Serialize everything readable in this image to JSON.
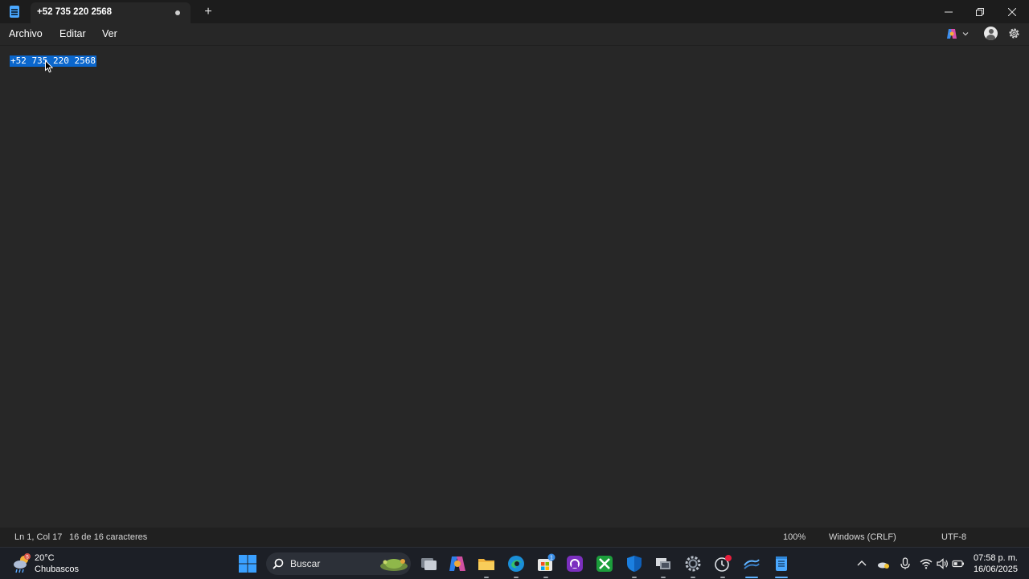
{
  "window": {
    "tab_title": "+52 735 220 2568",
    "new_tab_symbol": "+",
    "controls": [
      "minimize-icon",
      "maximize-icon",
      "close-icon"
    ]
  },
  "menu": {
    "archivo": "Archivo",
    "editar": "Editar",
    "ver": "Ver"
  },
  "editor": {
    "content": "+52 735 220 2568",
    "selected": true
  },
  "statusbar": {
    "position": "Ln 1, Col 17",
    "chars": "16 de 16 caracteres",
    "zoom": "100%",
    "line_ending": "Windows (CRLF)",
    "encoding": "UTF-8"
  },
  "taskbar": {
    "weather": {
      "badge": "5",
      "temp": "20°C",
      "condition": "Chubascos"
    },
    "search_placeholder": "Buscar",
    "store_badge": "1",
    "apps": [
      "task-view-icon",
      "copilot-icon",
      "file-explorer-icon",
      "edge-icon",
      "store-icon",
      "app-icon",
      "xbox-icon",
      "defender-icon",
      "remote-desktop-icon",
      "settings-icon",
      "recorder-icon",
      "fan-app-icon",
      "notepad-icon"
    ],
    "clock": {
      "time": "07:58 p. m.",
      "date": "16/06/2025"
    }
  },
  "colors": {
    "accent": "#0a66cc",
    "background": "#272727",
    "taskbar": "#1c1f26"
  }
}
